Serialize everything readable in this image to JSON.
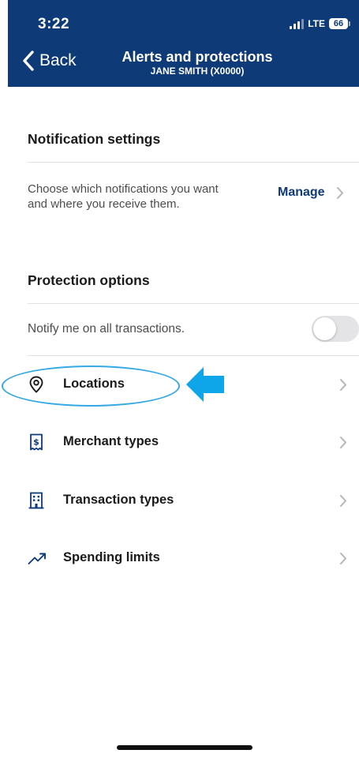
{
  "status_bar": {
    "time": "3:22",
    "network": "LTE",
    "battery": "66"
  },
  "nav": {
    "back_label": "Back",
    "title": "Alerts and protections",
    "subtitle": "JANE SMITH (X0000)"
  },
  "notification_settings": {
    "heading": "Notification settings",
    "description": "Choose which notifications you want and where you receive them.",
    "manage_label": "Manage"
  },
  "protection_options": {
    "heading": "Protection options",
    "notify_all_label": "Notify me on all transactions.",
    "notify_all_enabled": false,
    "items": [
      {
        "label": "Locations",
        "icon": "location-pin-icon",
        "highlighted": true
      },
      {
        "label": "Merchant types",
        "icon": "receipt-dollar-icon",
        "highlighted": false
      },
      {
        "label": "Transaction types",
        "icon": "building-icon",
        "highlighted": false
      },
      {
        "label": "Spending limits",
        "icon": "trend-up-icon",
        "highlighted": false
      }
    ]
  },
  "colors": {
    "header_bg": "#0e3a78",
    "accent": "#0e3a78",
    "annotation": "#35a9e6",
    "toggle_off": "#e4e4e7"
  }
}
